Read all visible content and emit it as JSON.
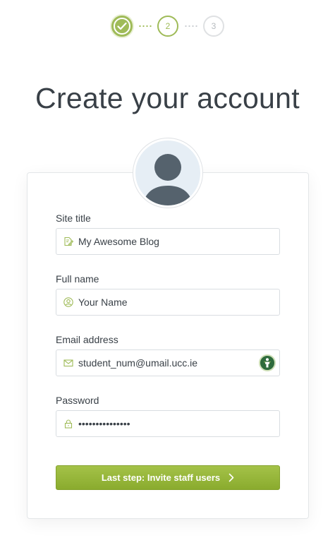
{
  "steps": {
    "step1": "",
    "step2": "2",
    "step3": "3"
  },
  "page": {
    "title": "Create your account"
  },
  "form": {
    "site_title": {
      "label": "Site title",
      "value": "My Awesome Blog"
    },
    "full_name": {
      "label": "Full name",
      "value": "Your Name"
    },
    "email": {
      "label": "Email address",
      "value": "student_num@umail.ucc.ie"
    },
    "password": {
      "label": "Password",
      "value": "•••••••••••••••"
    },
    "submit_label": "Last step: Invite staff users"
  },
  "colors": {
    "accent": "#9fbb58",
    "text": "#394047",
    "button": "#9ab83b"
  },
  "icons": {
    "step1": "check-icon",
    "site_title": "edit-icon",
    "full_name": "user-icon",
    "email": "mail-icon",
    "password": "lock-icon",
    "email_badge": "extension-badge-icon",
    "submit": "chevron-right-icon"
  }
}
